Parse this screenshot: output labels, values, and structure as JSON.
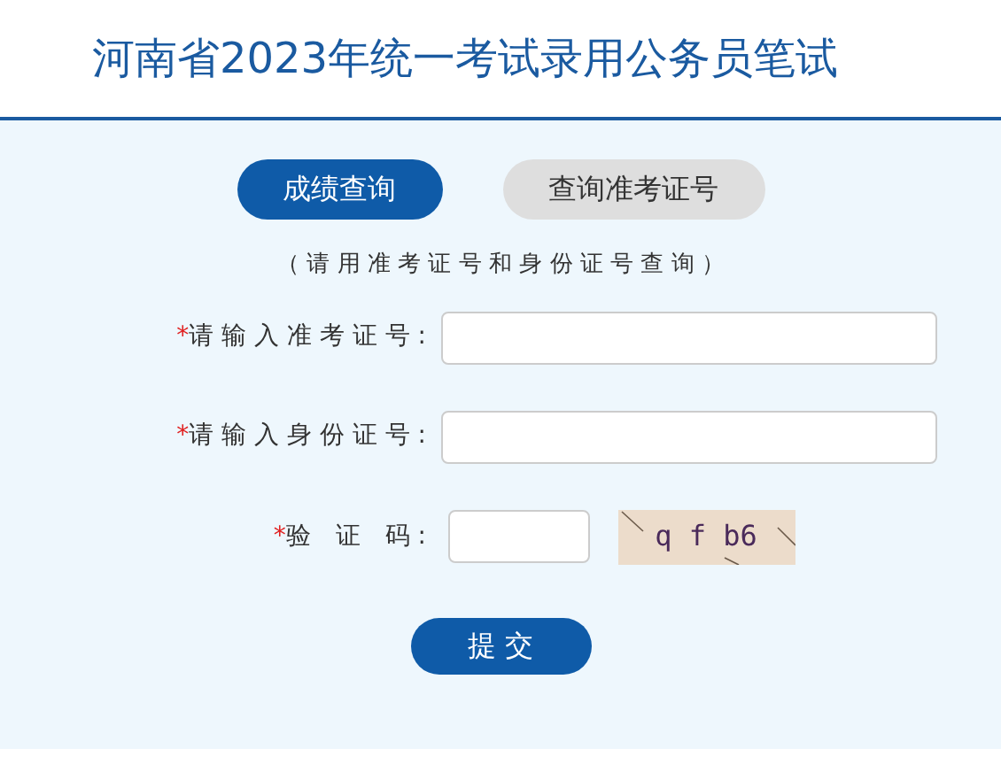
{
  "header": {
    "title": "河南省2023年统一考试录用公务员笔试"
  },
  "tabs": [
    {
      "label": "成绩查询",
      "selected": true
    },
    {
      "label": "查询准考证号",
      "selected": false
    }
  ],
  "hint": "（ 请 用 准 考 证 号 和 身 份 证 号 查 询 ）",
  "fields": [
    {
      "kind": "text",
      "label": "请 输 入 准 考 证 号 :",
      "required_mark": "*"
    },
    {
      "kind": "text",
      "label": "请 输 入 身 份 证 号 :",
      "required_mark": "*"
    },
    {
      "kind": "captcha",
      "label": "验　证　码 :",
      "required_mark": "*",
      "captcha": "q f b6"
    }
  ],
  "submit": "提 交"
}
